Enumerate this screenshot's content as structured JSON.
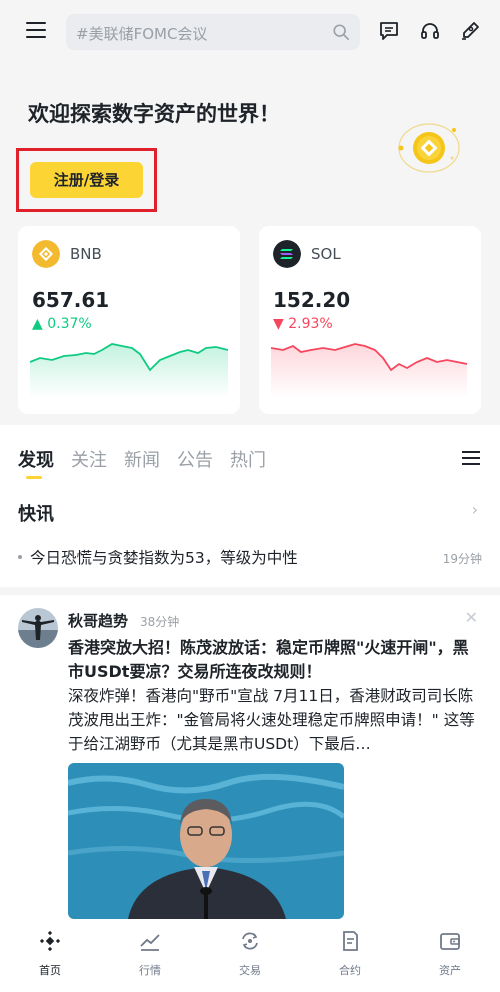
{
  "search": {
    "placeholder": "#美联储FOMC会议"
  },
  "hero": {
    "welcome": "欢迎探索数字资产的世界！",
    "login_label": "注册/登录"
  },
  "cards": [
    {
      "symbol": "BNB",
      "price": "657.61",
      "change": "0.37%",
      "direction": "up",
      "color": "#0ecb81",
      "logo_color": "#f3ba2f"
    },
    {
      "symbol": "SOL",
      "price": "152.20",
      "change": "2.93%",
      "direction": "down",
      "color": "#f6465d",
      "logo_color": "#1e2329"
    }
  ],
  "tabs": [
    "发现",
    "关注",
    "新闻",
    "公告",
    "热门"
  ],
  "flash": {
    "title": "快讯",
    "item": {
      "text": "今日恐慌与贪婪指数为53，等级为中性",
      "time": "19分钟"
    }
  },
  "post": {
    "author": "秋哥趋势",
    "time": "38分钟",
    "title": "香港突放大招！陈茂波放话：稳定币牌照\"火速开闸\"，黑市USDt要凉？交易所连夜改规则！",
    "body": "深夜炸弹！香港向\"野币\"宣战 7月11日，香港财政司司长陈茂波甩出王炸：\"金管局将火速处理稳定币牌照申请！\" 这等于给江湖野币（尤其是黑市USDt）下最后…"
  },
  "bottom_nav": [
    "首页",
    "行情",
    "交易",
    "合约",
    "资产"
  ],
  "colors": {
    "accent": "#fcd535",
    "up": "#0ecb81",
    "down": "#f6465d"
  }
}
